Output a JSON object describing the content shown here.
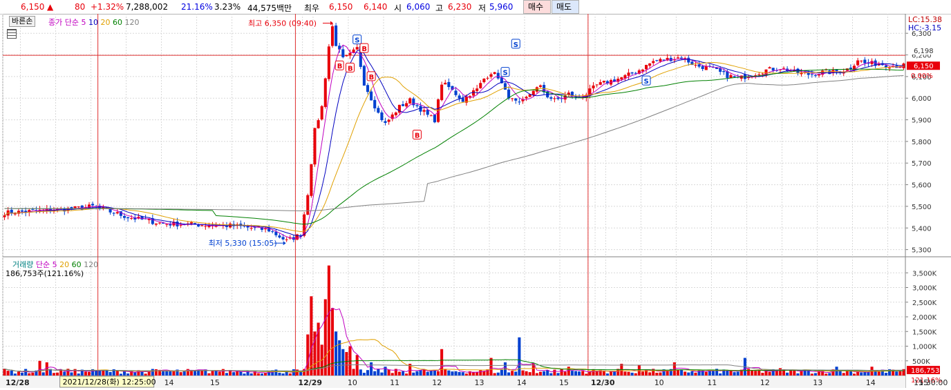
{
  "quote": {
    "price": "6,150",
    "arrow": "▲",
    "change": "80",
    "change_pct": "+1.32%",
    "volume": "7,288,002",
    "vol_ratio": "21.16%",
    "turnover": "3.23%",
    "amount": "44,575백만",
    "best_label": "최우",
    "best_ask": "6,150",
    "best_bid": "6,140",
    "open_label": "시",
    "open": "6,060",
    "high_label": "고",
    "high": "6,230",
    "low_label": "저",
    "low": "5,960",
    "buy_button": "매수",
    "sell_button": "매도"
  },
  "toolbar": {
    "mode_button": "바른손"
  },
  "price_legend": {
    "label": "종가 단순",
    "periods": [
      "5",
      "10",
      "20",
      "60",
      "120"
    ],
    "colors": [
      "#c000c0",
      "#0000c0",
      "#e0a000",
      "#008000",
      "#808080"
    ]
  },
  "volume_legend": {
    "label": "거래량",
    "ma_label": "단순",
    "periods": [
      "5",
      "20",
      "60",
      "120"
    ],
    "current": "186,753주(121.16%)"
  },
  "right_info": {
    "lc": "LC:15.38",
    "hc": "HC:-3.15"
  },
  "annotations": {
    "high": "최고 6,350 (09:40)",
    "low": "최저 5,330 (15:05)",
    "price_tag": "6,198",
    "current_tag": "6,150",
    "pct_tag": "0.00%",
    "vol_tag": "186,753",
    "vol_pct_tag": "121.16%",
    "cursor_date": "2021/12/28(화) 12:25:00",
    "time_label": "15:30:00"
  },
  "colors": {
    "up": "#e8000b",
    "down": "#0040d0",
    "grid": "#d8d8d8",
    "ref_line": "#e03030"
  },
  "chart_data": [
    {
      "type": "candlestick",
      "title": "",
      "ylim": [
        5270,
        6390
      ],
      "y_ticks": [
        5300,
        5400,
        5500,
        5600,
        5700,
        5800,
        5900,
        6000,
        6100,
        6200,
        6300
      ],
      "y_tick_labels": [
        "5,300",
        "5,400",
        "5,500",
        "5,600",
        "5,700",
        "5,800",
        "5,900",
        "6,000",
        "6,100",
        "6,200",
        "6,300"
      ],
      "x_labels": [
        "12/28",
        "14",
        "15",
        "12/29",
        "10",
        "11",
        "12",
        "13",
        "14",
        "15",
        "12/30",
        "10",
        "11",
        "12",
        "13",
        "14",
        "15"
      ],
      "highlight_line": 6198,
      "high_value": 6350,
      "low_value": 5330,
      "anchors": [
        [
          0,
          5470
        ],
        [
          10,
          5480
        ],
        [
          20,
          5490
        ],
        [
          25,
          5500
        ],
        [
          35,
          5450
        ],
        [
          45,
          5420
        ],
        [
          55,
          5415
        ],
        [
          65,
          5410
        ],
        [
          75,
          5390
        ],
        [
          80,
          5340
        ],
        [
          84,
          5370
        ],
        [
          86,
          5560
        ],
        [
          88,
          5850
        ],
        [
          90,
          5960
        ],
        [
          92,
          6240
        ],
        [
          93,
          6330
        ],
        [
          94,
          6250
        ],
        [
          96,
          6180
        ],
        [
          98,
          6200
        ],
        [
          100,
          6230
        ],
        [
          102,
          6070
        ],
        [
          104,
          6000
        ],
        [
          106,
          5930
        ],
        [
          108,
          5880
        ],
        [
          110,
          5920
        ],
        [
          112,
          5960
        ],
        [
          115,
          5990
        ],
        [
          118,
          5950
        ],
        [
          120,
          5920
        ],
        [
          122,
          5900
        ],
        [
          124,
          6070
        ],
        [
          126,
          6050
        ],
        [
          128,
          6020
        ],
        [
          130,
          5990
        ],
        [
          132,
          6020
        ],
        [
          134,
          6040
        ],
        [
          136,
          6090
        ],
        [
          138,
          6120
        ],
        [
          140,
          6100
        ],
        [
          142,
          6030
        ],
        [
          144,
          5990
        ],
        [
          146,
          5970
        ],
        [
          148,
          6000
        ],
        [
          150,
          6040
        ],
        [
          152,
          6050
        ],
        [
          154,
          6010
        ],
        [
          156,
          5990
        ],
        [
          158,
          6000
        ],
        [
          160,
          6020
        ],
        [
          162,
          6000
        ],
        [
          165,
          6020
        ],
        [
          168,
          6060
        ],
        [
          172,
          6080
        ],
        [
          176,
          6100
        ],
        [
          180,
          6130
        ],
        [
          184,
          6170
        ],
        [
          188,
          6180
        ],
        [
          192,
          6190
        ],
        [
          196,
          6150
        ],
        [
          200,
          6140
        ],
        [
          204,
          6110
        ],
        [
          208,
          6090
        ],
        [
          212,
          6110
        ],
        [
          216,
          6130
        ],
        [
          220,
          6140
        ],
        [
          224,
          6120
        ],
        [
          228,
          6110
        ],
        [
          232,
          6120
        ],
        [
          236,
          6120
        ],
        [
          240,
          6140
        ],
        [
          242,
          6180
        ],
        [
          244,
          6160
        ],
        [
          248,
          6160
        ],
        [
          252,
          6150
        ],
        [
          255,
          6150
        ]
      ],
      "ma": [
        {
          "name": "5",
          "color": "#c000c0",
          "window": 5
        },
        {
          "name": "10",
          "color": "#0000c0",
          "window": 10
        },
        {
          "name": "20",
          "color": "#e0a000",
          "window": 20
        },
        {
          "name": "60",
          "color": "#008000",
          "window": 60
        },
        {
          "name": "120",
          "color": "#808080",
          "window": 120
        }
      ],
      "signals": [
        {
          "type": "B",
          "bar": 95,
          "value": 6150
        },
        {
          "type": "B",
          "bar": 98,
          "value": 6140
        },
        {
          "type": "S",
          "bar": 100,
          "value": 6270
        },
        {
          "type": "B",
          "bar": 102,
          "value": 6230
        },
        {
          "type": "B",
          "bar": 104,
          "value": 6100
        },
        {
          "type": "B",
          "bar": 117,
          "value": 5830
        },
        {
          "type": "S",
          "bar": 142,
          "value": 6120
        },
        {
          "type": "S",
          "bar": 145,
          "value": 6250
        },
        {
          "type": "S",
          "bar": 182,
          "value": 6080
        }
      ]
    },
    {
      "type": "bar",
      "title": "",
      "ylim": [
        0,
        4000000
      ],
      "y_ticks": [
        500000,
        1000000,
        1500000,
        2000000,
        2500000,
        3000000,
        3500000
      ],
      "y_tick_labels": [
        "500K",
        "1,000K",
        "1,500K",
        "2,000K",
        "2,500K",
        "3,000K",
        "3,500K"
      ],
      "spikes": [
        [
          10,
          500000
        ],
        [
          12,
          450000
        ],
        [
          20,
          220000
        ],
        [
          28,
          200000
        ],
        [
          41,
          150000
        ],
        [
          60,
          180000
        ],
        [
          86,
          1400000
        ],
        [
          87,
          2700000
        ],
        [
          88,
          1500000
        ],
        [
          89,
          1800000
        ],
        [
          90,
          1050000
        ],
        [
          91,
          2600000
        ],
        [
          92,
          3750000
        ],
        [
          93,
          2300000
        ],
        [
          94,
          1500000
        ],
        [
          95,
          1200000
        ],
        [
          96,
          900000
        ],
        [
          97,
          800000
        ],
        [
          98,
          1000000
        ],
        [
          100,
          700000
        ],
        [
          104,
          450000
        ],
        [
          108,
          300000
        ],
        [
          115,
          400000
        ],
        [
          124,
          900000
        ],
        [
          138,
          600000
        ],
        [
          142,
          450000
        ],
        [
          146,
          1300000
        ],
        [
          150,
          400000
        ],
        [
          160,
          300000
        ],
        [
          175,
          400000
        ],
        [
          180,
          350000
        ],
        [
          190,
          450000
        ],
        [
          210,
          600000
        ],
        [
          220,
          250000
        ],
        [
          236,
          300000
        ],
        [
          246,
          300000
        ],
        [
          252,
          200000
        ]
      ],
      "current": 186753
    }
  ]
}
